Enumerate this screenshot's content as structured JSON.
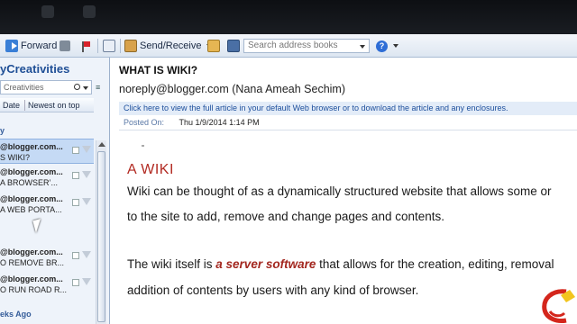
{
  "toolbar": {
    "forward_label": "Forward",
    "send_receive_label": "Send/Receive",
    "search_placeholder": "Search address books"
  },
  "folder": {
    "title": "yCreativities",
    "search_placeholder": "Creativities",
    "sort_by": "Date",
    "sort_order": "Newest on top",
    "group_top": "y",
    "group_bottom": "eks Ago"
  },
  "messages": [
    {
      "from": "@blogger.com...",
      "subject": "S WIKI?",
      "selected": true
    },
    {
      "from": "@blogger.com...",
      "subject": "A BROWSER’...",
      "selected": false
    },
    {
      "from": "@blogger.com...",
      "subject": "A WEB PORTA...",
      "selected": false
    },
    {
      "from": "@blogger.com...",
      "subject": "O REMOVE BR...",
      "selected": false
    },
    {
      "from": "@blogger.com...",
      "subject": "O RUN ROAD R...",
      "selected": false
    }
  ],
  "reading": {
    "subject": "WHAT IS WIKI?",
    "sender": "noreply@blogger.com (Nana Ameah Sechim)",
    "infobar": "Click here to view the full article in your default Web browser or to download the article and any enclosures.",
    "posted_label": "Posted On:",
    "posted_value": "Thu 1/9/2014 1:14 PM",
    "heading": "A WIKI",
    "p1_line1": "Wiki can be thought of as a website that allows some or",
    "p1_line1_a": "Wiki can be thought of as a dynamically structured website that allows some or",
    "p1_line2": "to the site to add, remove and change pages and contents.",
    "p2_line1_pre": "The wiki itself is ",
    "p2_line1_em": "a server software",
    "p2_line1_post": " that allows for  the creation, editing, removal",
    "p2_line2": "addition of contents by users with any kind of browser."
  }
}
